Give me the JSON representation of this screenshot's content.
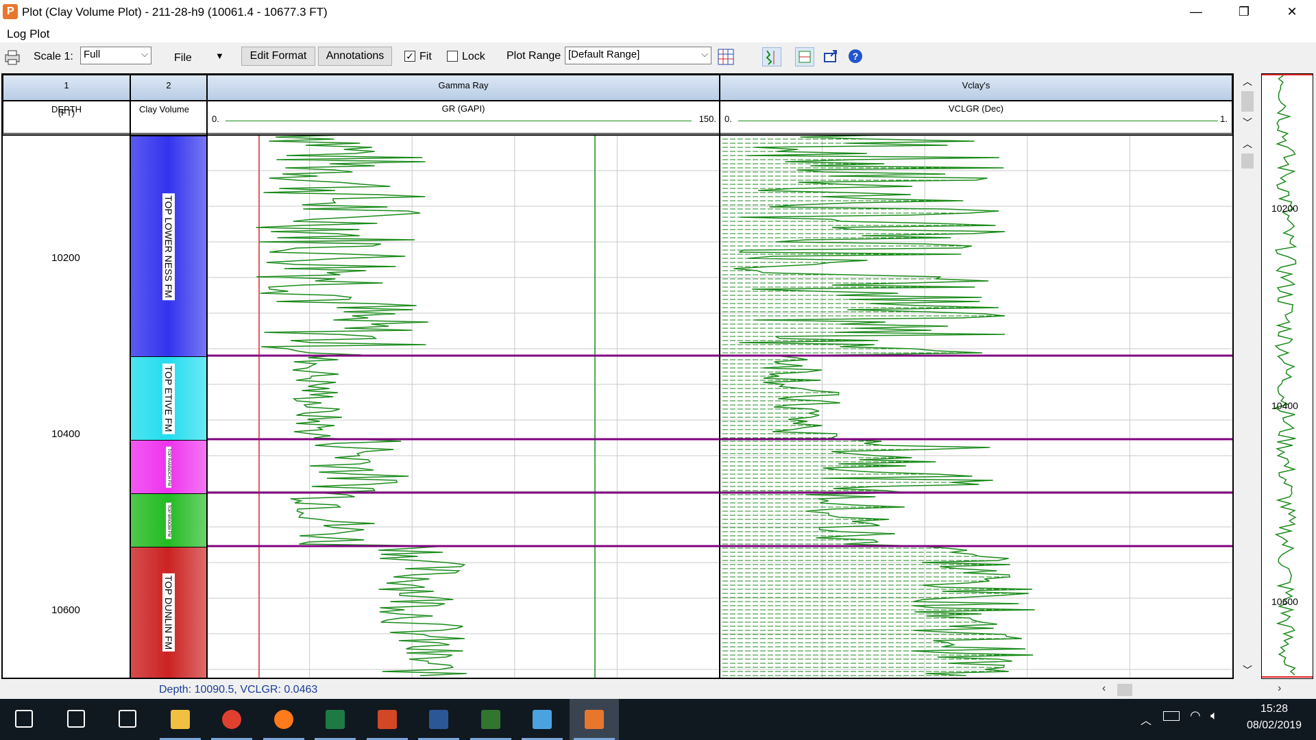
{
  "window": {
    "title": "Plot (Clay Volume Plot) - 211-28-h9 (10061.4 - 10677.3 FT)",
    "minimize_glyph": "—",
    "restore_glyph": "❐",
    "close_glyph": "✕"
  },
  "menu": {
    "title": "Log Plot"
  },
  "toolbar": {
    "scale_label": "Scale 1:",
    "scale_value": "Full",
    "file_label": "File",
    "edit_format_label": "Edit Format",
    "annotations_label": "Annotations",
    "fit_label": "Fit",
    "fit_checked": true,
    "lock_label": "Lock",
    "lock_checked": false,
    "plot_range_label": "Plot Range",
    "plot_range_value": "[Default Range]",
    "icons": [
      "print-icon",
      "track-layout-icon",
      "zoom-fit-icon",
      "zoom-select-icon",
      "export-icon",
      "help-icon"
    ]
  },
  "tracks": [
    {
      "number": "1",
      "title": "DEPTH",
      "unit": "(FT)"
    },
    {
      "number": "2",
      "title": "Clay Volume"
    },
    {
      "number": "",
      "title": "Gamma Ray",
      "curve": "GR (GAPI)",
      "scale_min": "0.",
      "scale_max": "150."
    },
    {
      "number": "",
      "title": "Vclay's",
      "curve": "VCLGR (Dec)",
      "scale_min": "0.",
      "scale_max": "1."
    }
  ],
  "depth_labels": [
    "10200",
    "10400",
    "10600"
  ],
  "overview_depth_labels": [
    "10200",
    "10400",
    "10600"
  ],
  "zones": [
    {
      "name": "TOP LOWER NESS FM",
      "color": "#3333ee"
    },
    {
      "name": "TOP ETIVE FM",
      "color": "#22ddee"
    },
    {
      "name": "TOP RANNOCH FM",
      "color": "#ee33ee"
    },
    {
      "name": "TOP BROOM FM",
      "color": "#22bb22"
    },
    {
      "name": "TOP DUNLIN FM",
      "color": "#cc2222"
    }
  ],
  "colors": {
    "curve": "#1a8a1a",
    "zone_boundary": "#800080",
    "gr_left_marker": "#e02020"
  },
  "status": {
    "text": "Depth: 10090.5,   VCLGR: 0.0463"
  },
  "taskbar": {
    "time": "15:28",
    "date": "08/02/2019",
    "apps": [
      "start-icon",
      "search-icon",
      "task-view-icon",
      "file-explorer-icon",
      "chrome-icon",
      "firefox-icon",
      "excel-icon",
      "powerpoint-icon",
      "word-icon",
      "project-icon",
      "onedrive-icon",
      "techlog-icon"
    ]
  }
}
